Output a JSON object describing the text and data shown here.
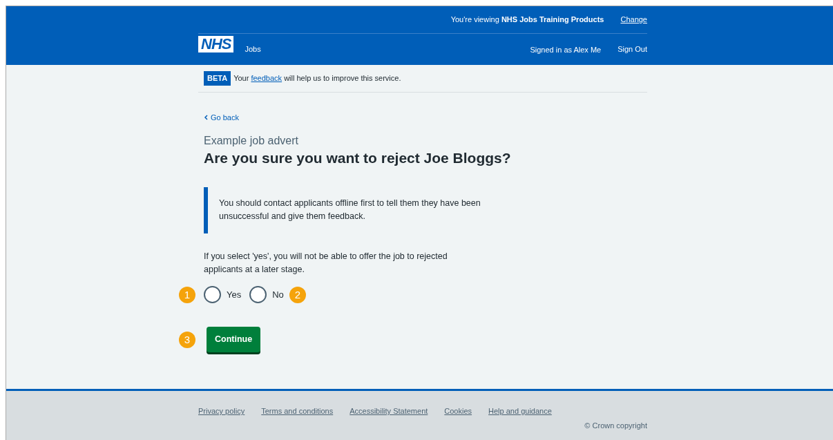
{
  "header": {
    "context": "You're viewing **NHS Jobs Training Products**",
    "change_link": "Change",
    "logo": "NHS",
    "service": "Jobs",
    "signed_in": "Signed in as Alex Me",
    "sign_out": "Sign Out"
  },
  "beta": {
    "tag": "BETA",
    "before": "Your ",
    "link": "feedback",
    "after": " will help us to improve this service."
  },
  "back_link": "Go back",
  "caption": "Example job advert",
  "heading": "Are you sure you want to reject Joe Bloggs?",
  "inset_text": "You should contact applicants offline first to tell them they have been unsuccessful and give them feedback.",
  "hint": "If you select 'yes', you will not be able to offer the job to rejected applicants at a later stage.",
  "options": [
    {
      "label": "Yes",
      "checked": false,
      "callout": "1",
      "callout_before": true
    },
    {
      "label": "No",
      "checked": false,
      "callout": "2",
      "callout_before": false
    }
  ],
  "button": {
    "label": "Continue",
    "callout": "3"
  },
  "footer": {
    "links": [
      "Privacy policy",
      "Terms and conditions",
      "Accessibility Statement",
      "Cookies",
      "Help and guidance"
    ],
    "copyright": "© Crown copyright"
  }
}
